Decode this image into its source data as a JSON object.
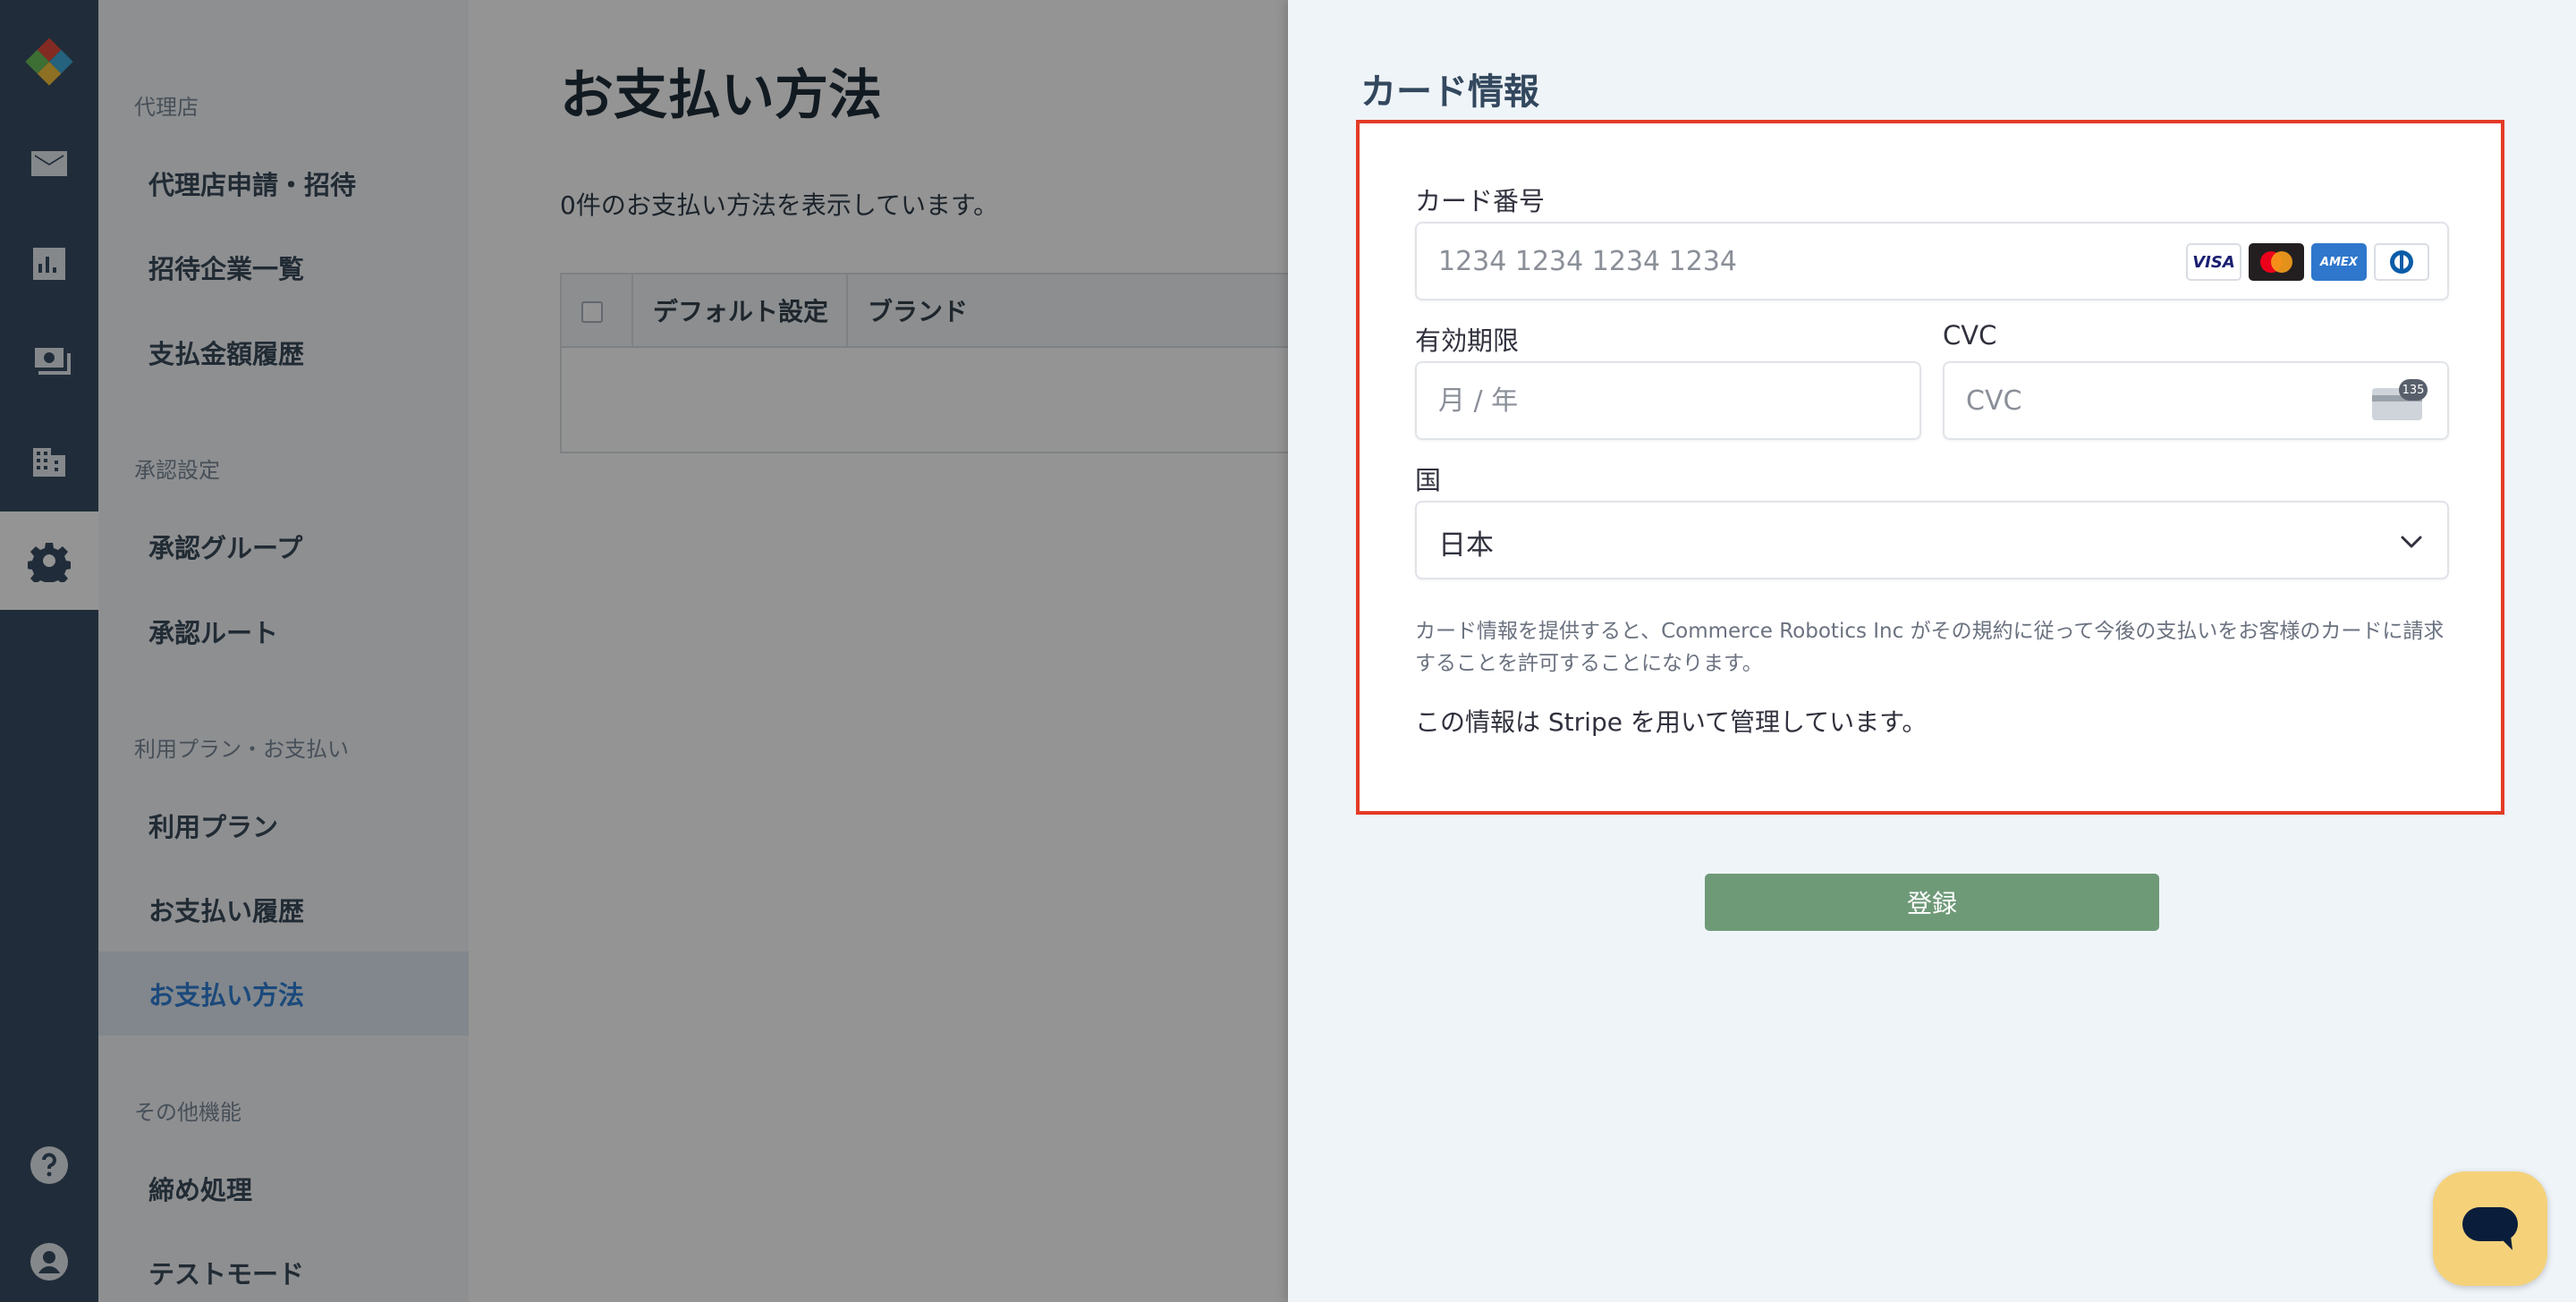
{
  "sidebar": {
    "sections": [
      {
        "title": "代理店",
        "items": [
          "代理店申請・招待",
          "招待企業一覧",
          "支払金額履歴"
        ]
      },
      {
        "title": "承認設定",
        "items": [
          "承認グループ",
          "承認ルート"
        ]
      },
      {
        "title": "利用プラン・お支払い",
        "items": [
          "利用プラン",
          "お支払い履歴",
          "お支払い方法"
        ]
      },
      {
        "title": "その他機能",
        "items": [
          "締め処理",
          "テストモード"
        ]
      }
    ],
    "active_item": "お支払い方法"
  },
  "rail": {
    "icons": [
      "logo-icon",
      "mail-icon",
      "chart-icon",
      "payments-icon",
      "building-icon",
      "gear-icon",
      "help-icon",
      "account-icon"
    ],
    "active": "gear-icon"
  },
  "main": {
    "title": "お支払い方法",
    "count_text": "0件のお支払い方法を表示しています。",
    "table_headers": [
      "デフォルト設定",
      "ブランド"
    ]
  },
  "drawer": {
    "title": "カード情報",
    "card_number_label": "カード番号",
    "card_number_placeholder": "1234 1234 1234 1234",
    "card_brands": [
      "VISA",
      "MC",
      "AMEX",
      "DINERS"
    ],
    "expiry_label": "有効期限",
    "expiry_placeholder": "月 / 年",
    "cvc_label": "CVC",
    "cvc_placeholder": "CVC",
    "cvc_badge": "135",
    "country_label": "国",
    "country_value": "日本",
    "consent_text": "カード情報を提供すると、Commerce Robotics Inc がその規約に従って今後の支払いをお客様のカードに請求することを許可することになります。",
    "stripe_note": "この情報は Stripe を用いて管理しています。",
    "register_label": "登録"
  },
  "colors": {
    "rail": "#374d63",
    "active_nav": "#2f7fd6",
    "highlight_border": "#e33b26",
    "register_button": "#6f9a78",
    "chat_button": "#f5d27a"
  }
}
